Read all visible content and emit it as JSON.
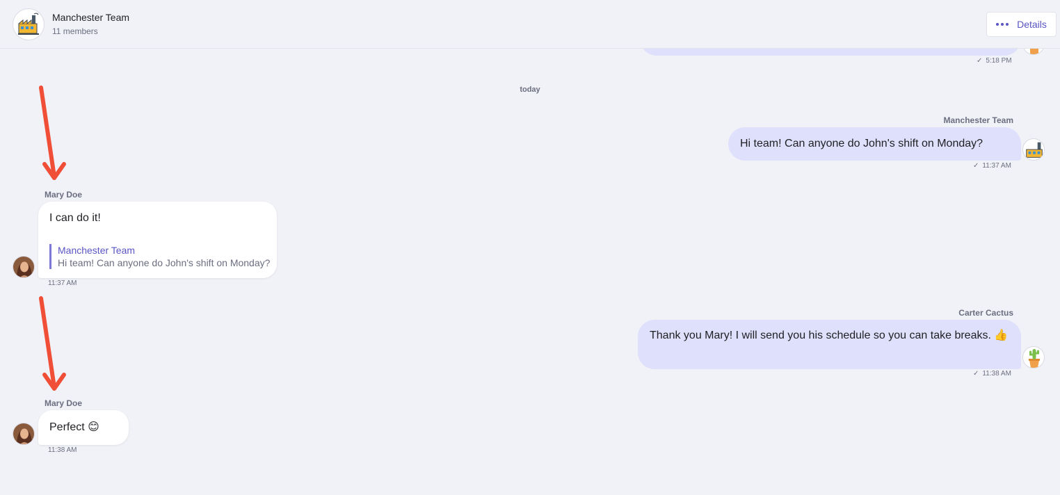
{
  "header": {
    "title": "Manchester Team",
    "subtitle": "11 members",
    "details_label": "Details"
  },
  "previous_message": {
    "time": "5:18 PM"
  },
  "day_separator": "today",
  "messages": [
    {
      "sender": "Manchester Team",
      "text": "Hi team! Can anyone do John's shift on Monday?",
      "time": "11:37 AM",
      "direction": "outgoing",
      "avatar": "factory-icon"
    },
    {
      "sender": "Mary Doe",
      "text": "I can do it!",
      "time": "11:37 AM",
      "direction": "incoming",
      "avatar": "woman-avatar",
      "reply_to": {
        "author": "Manchester Team",
        "text": "Hi team! Can anyone do John's shift on Monday?"
      }
    },
    {
      "sender": "Carter Cactus",
      "text": "Thank you Mary! I will send you his schedule so you can take breaks. 👍",
      "time": "11:38 AM",
      "direction": "outgoing",
      "avatar": "cactus-icon"
    },
    {
      "sender": "Mary Doe",
      "text": "Perfect 😊",
      "time": "11:38 AM",
      "direction": "incoming",
      "avatar": "woman-avatar"
    }
  ],
  "colors": {
    "background": "#f1f2f7",
    "outgoing_bubble": "#dfe0fb",
    "incoming_bubble": "#ffffff",
    "accent": "#5a55c4",
    "annotation_arrow": "#f04e37"
  }
}
